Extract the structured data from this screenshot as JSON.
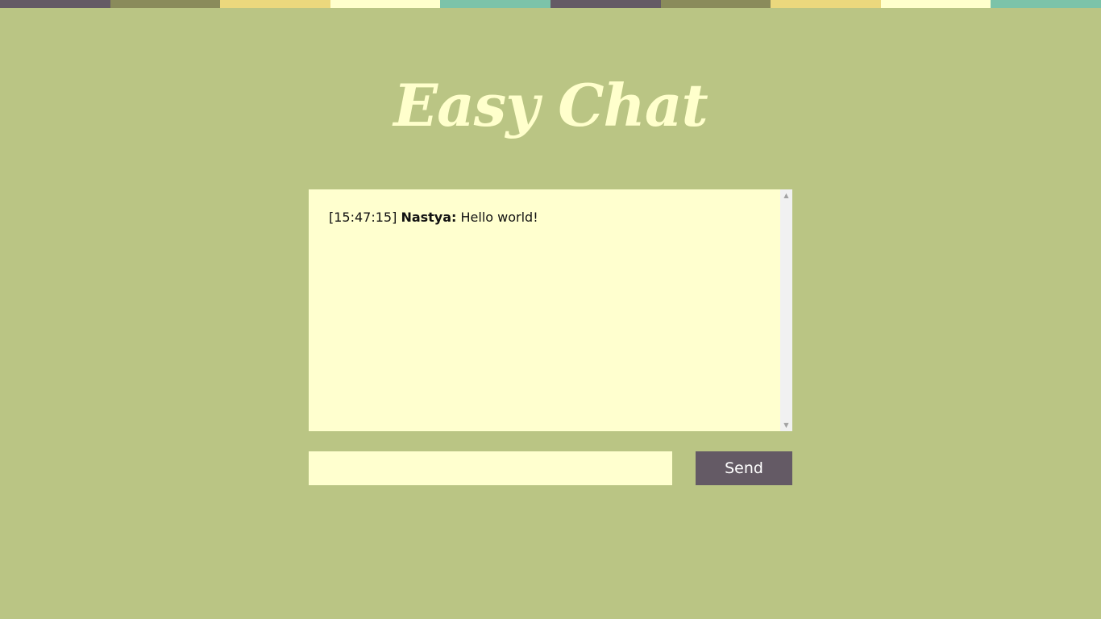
{
  "stripe_colors": [
    "#645a65",
    "#8a8b5b",
    "#ebd87d",
    "#ffffcc",
    "#7cc3a9",
    "#645a65",
    "#8a8b5b",
    "#ebd87d",
    "#ffffcc",
    "#7cc3a9"
  ],
  "app": {
    "title": "Easy Chat"
  },
  "chat": {
    "messages": [
      {
        "time": "[15:47:15]",
        "author": "Nastya:",
        "text": "Hello world!"
      }
    ]
  },
  "composer": {
    "input_value": "",
    "input_placeholder": "",
    "send_label": "Send"
  },
  "colors": {
    "background": "#bac584",
    "panel": "#ffffcf",
    "title": "#ffffcc",
    "button": "#645a65"
  },
  "icons": {
    "scroll_up": "scroll-up-arrow-icon",
    "scroll_down": "scroll-down-arrow-icon"
  }
}
